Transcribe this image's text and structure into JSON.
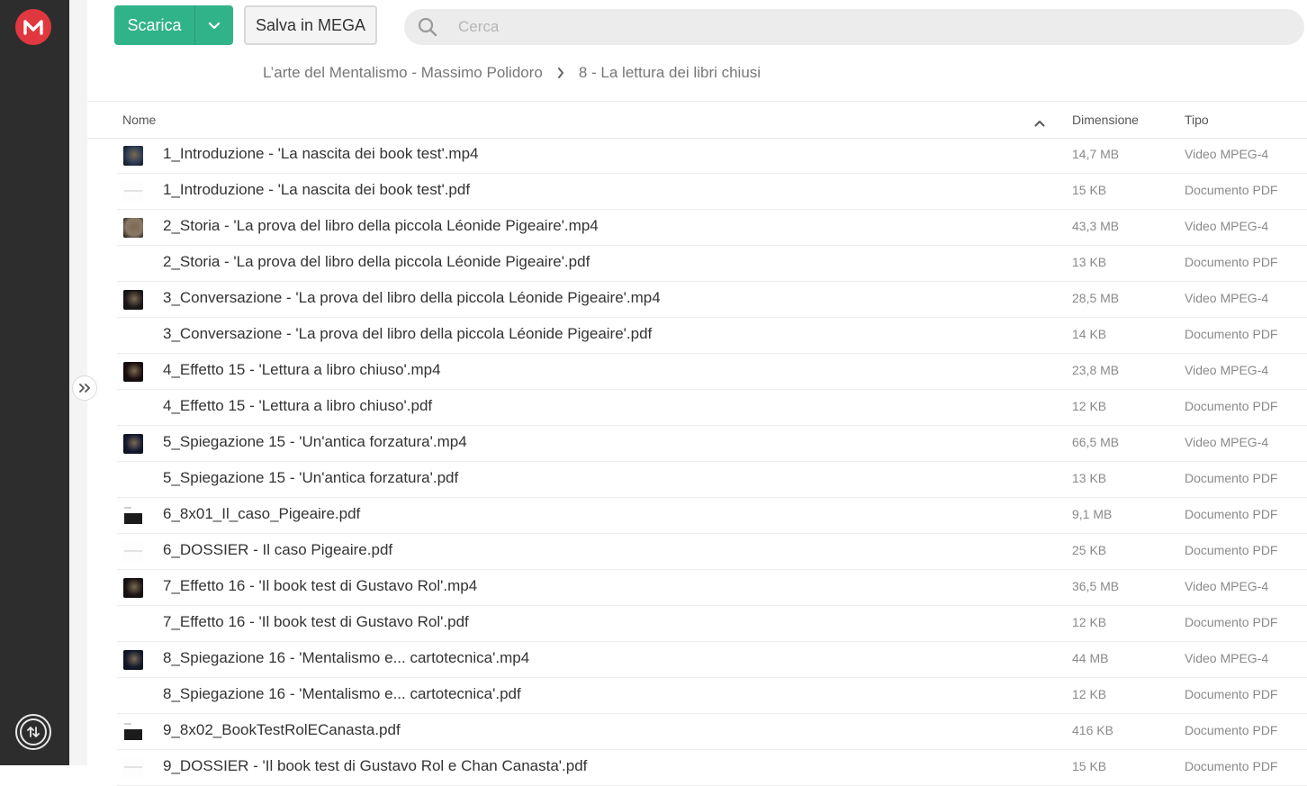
{
  "toolbar": {
    "download_label": "Scarica",
    "save_label": "Salva in MEGA",
    "search_placeholder": "Cerca"
  },
  "breadcrumb": {
    "parent": "L’arte del Mentalismo - Massimo Polidoro",
    "current": "8 - La lettura dei libri chiusi"
  },
  "table": {
    "headers": {
      "name": "Nome",
      "size": "Dimensione",
      "type": "Tipo"
    },
    "rows": [
      {
        "name": "1_Introduzione - 'La nascita dei book test'.mp4",
        "size": "14,7 MB",
        "type": "Video MPEG-4",
        "thumb": "video",
        "color": "#2b3a55"
      },
      {
        "name": "1_Introduzione - 'La nascita dei book test'.pdf",
        "size": "15 KB",
        "type": "Documento PDF",
        "thumb": "pdf"
      },
      {
        "name": "2_Storia - 'La prova del libro della piccola Léonide Pigeaire'.mp4",
        "size": "43,3 MB",
        "type": "Video MPEG-4",
        "thumb": "video",
        "color": "#8a7a66"
      },
      {
        "name": "2_Storia - 'La prova del libro della piccola Léonide Pigeaire'.pdf",
        "size": "13 KB",
        "type": "Documento PDF",
        "thumb": "blank"
      },
      {
        "name": "3_Conversazione - 'La prova del libro della piccola Léonide Pigeaire'.mp4",
        "size": "28,5 MB",
        "type": "Video MPEG-4",
        "thumb": "video",
        "color": "#1f1a1a"
      },
      {
        "name": "3_Conversazione - 'La prova del libro della piccola Léonide Pigeaire'.pdf",
        "size": "14 KB",
        "type": "Documento PDF",
        "thumb": "blank"
      },
      {
        "name": "4_Effetto 15 - 'Lettura a libro chiuso'.mp4",
        "size": "23,8 MB",
        "type": "Video MPEG-4",
        "thumb": "video",
        "color": "#1a0d0d"
      },
      {
        "name": "4_Effetto 15 - 'Lettura a libro chiuso'.pdf",
        "size": "12 KB",
        "type": "Documento PDF",
        "thumb": "blank"
      },
      {
        "name": "5_Spiegazione 15 - 'Un'antica forzatura'.mp4",
        "size": "66,5 MB",
        "type": "Video MPEG-4",
        "thumb": "video",
        "color": "#141a33"
      },
      {
        "name": "5_Spiegazione 15 - 'Un'antica forzatura'.pdf",
        "size": "13 KB",
        "type": "Documento PDF",
        "thumb": "blank"
      },
      {
        "name": "6_8x01_Il_caso_Pigeaire.pdf",
        "size": "9,1 MB",
        "type": "Documento PDF",
        "thumb": "doc"
      },
      {
        "name": "6_DOSSIER - Il caso Pigeaire.pdf",
        "size": "25 KB",
        "type": "Documento PDF",
        "thumb": "pdf"
      },
      {
        "name": "7_Effetto 16 - 'Il book test di Gustavo Rol'.mp4",
        "size": "36,5 MB",
        "type": "Video MPEG-4",
        "thumb": "video",
        "color": "#1c1414"
      },
      {
        "name": "7_Effetto 16 - 'Il book test di Gustavo Rol'.pdf",
        "size": "12 KB",
        "type": "Documento PDF",
        "thumb": "blank"
      },
      {
        "name": "8_Spiegazione 16 - 'Mentalismo e... cartotecnica'.mp4",
        "size": "44 MB",
        "type": "Video MPEG-4",
        "thumb": "video",
        "color": "#141a2e"
      },
      {
        "name": "8_Spiegazione 16 - 'Mentalismo e... cartotecnica'.pdf",
        "size": "12 KB",
        "type": "Documento PDF",
        "thumb": "blank"
      },
      {
        "name": "9_8x02_BookTestRolECanasta.pdf",
        "size": "416 KB",
        "type": "Documento PDF",
        "thumb": "doc"
      },
      {
        "name": "9_DOSSIER - 'Il book test di Gustavo Rol e Chan Canasta'.pdf",
        "size": "15 KB",
        "type": "Documento PDF",
        "thumb": "pdf"
      }
    ]
  },
  "colors": {
    "accent": "#31b38a",
    "brand": "#e0383e",
    "sidebar": "#2d2d2d"
  }
}
